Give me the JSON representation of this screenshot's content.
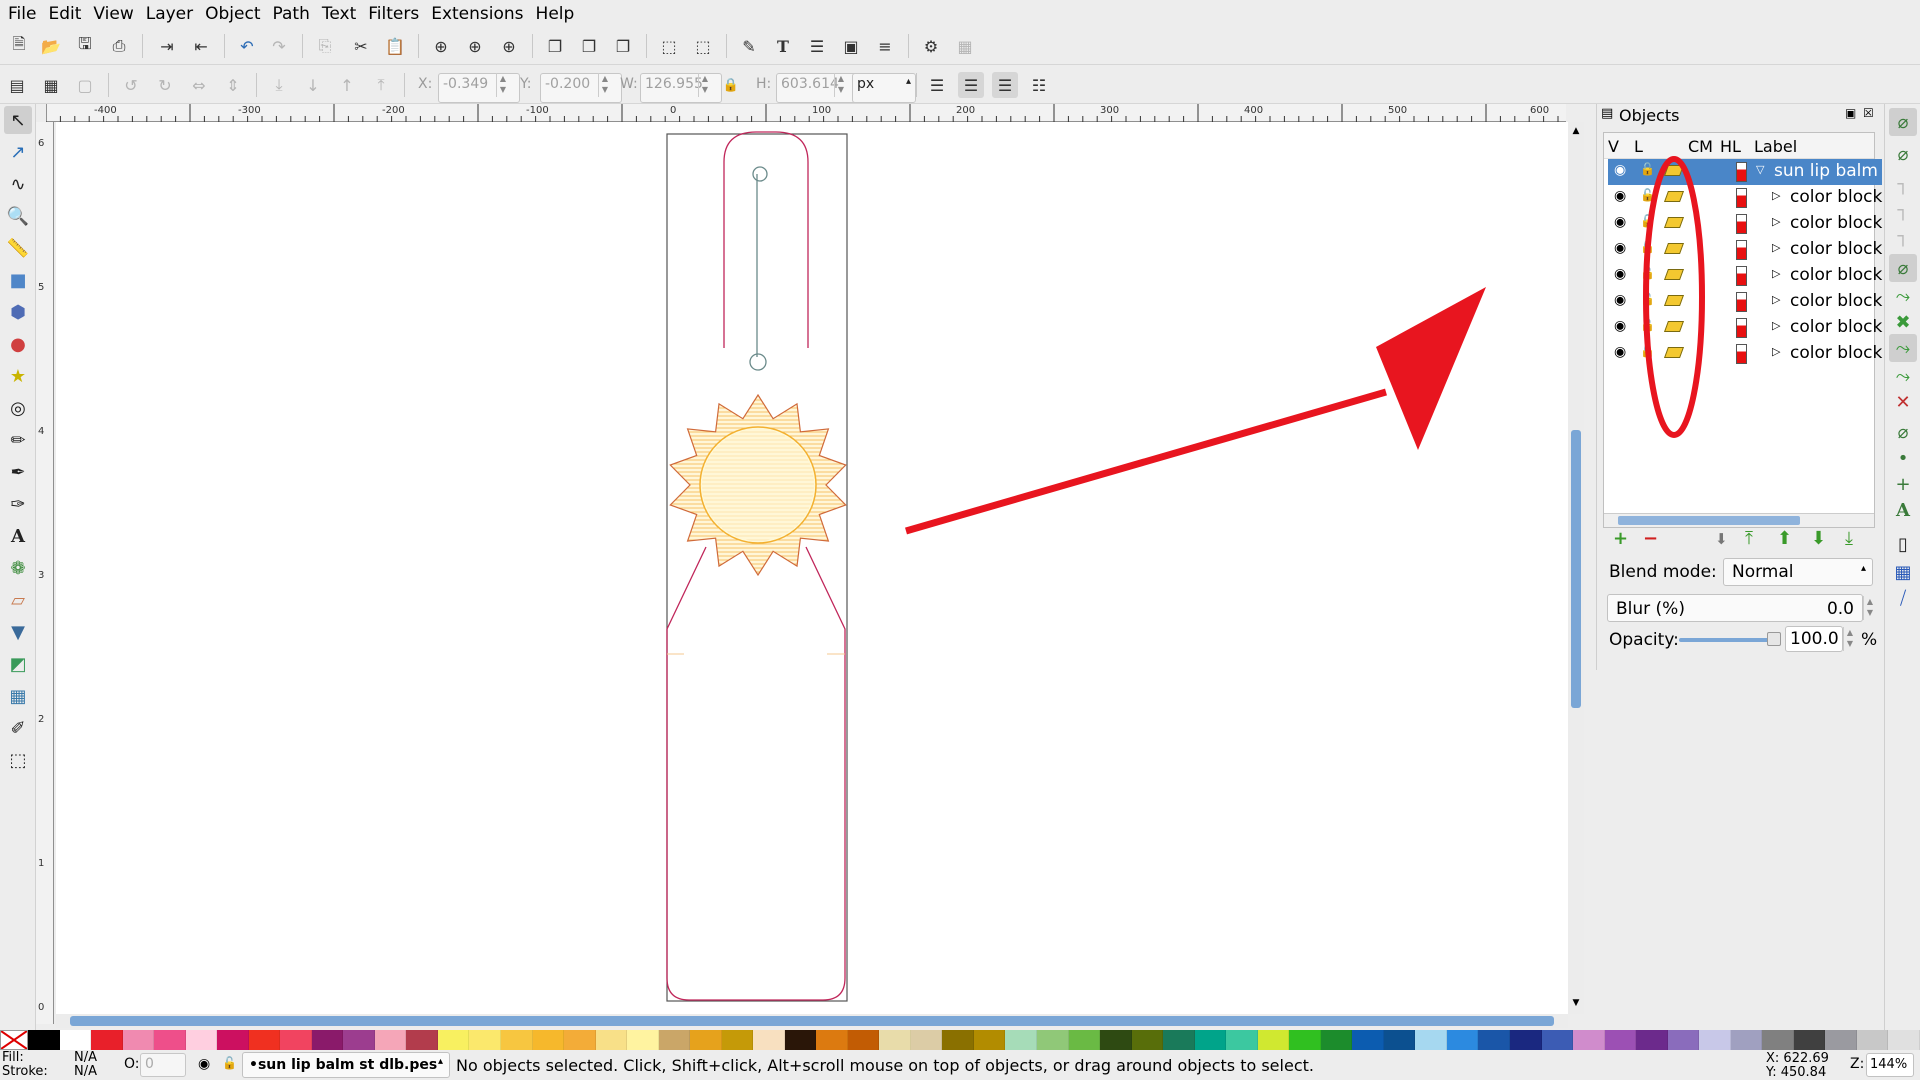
{
  "menu": [
    "File",
    "Edit",
    "View",
    "Layer",
    "Object",
    "Path",
    "Text",
    "Filters",
    "Extensions",
    "Help"
  ],
  "toolbar2": {
    "x_label": "X:",
    "x_value": "-0.349",
    "y_label": "Y:",
    "y_value": "-0.200",
    "w_label": "W:",
    "w_value": "126.955",
    "h_label": "H:",
    "h_value": "603.614",
    "unit": "px"
  },
  "ruler": {
    "h_labels": [
      "-400",
      "-300",
      "-200",
      "-100",
      "0",
      "100",
      "200",
      "300",
      "400",
      "500",
      "600"
    ],
    "v_labels": [
      "6",
      "5",
      "4",
      "3",
      "2",
      "1",
      "0"
    ]
  },
  "objects_panel": {
    "title": "Objects",
    "headers": [
      "V",
      "L",
      "",
      "CM",
      "HL",
      "Label"
    ],
    "rows": [
      {
        "label": "sun lip balm",
        "selected": true
      },
      {
        "label": "color block"
      },
      {
        "label": "color block"
      },
      {
        "label": "color block"
      },
      {
        "label": "color block"
      },
      {
        "label": "color block"
      },
      {
        "label": "color block"
      },
      {
        "label": "color block"
      }
    ],
    "blend_label": "Blend mode:",
    "blend_value": "Normal",
    "blur_label": "Blur (%)",
    "blur_value": "0.0",
    "opacity_label": "Opacity:",
    "opacity_value": "100.0",
    "opacity_unit": "%",
    "opacity_fraction": 1.0
  },
  "colors": {
    "accent": "#4a86c8",
    "annotation": "#e8151f",
    "outline": "#c0265a",
    "sun_fill": "#f7c65a",
    "palette": [
      "#000000",
      "#ffffff",
      "#e8202a",
      "#f08ab0",
      "#ee4f8a",
      "#ffcfe0",
      "#cc1060",
      "#f03020",
      "#f14460",
      "#8a1a6a",
      "#9c3d8f",
      "#f5a6b8",
      "#b23c4c",
      "#f8f060",
      "#fbe86c",
      "#f7c640",
      "#f6b82c",
      "#f3ac38",
      "#f8e088",
      "#fff3a0",
      "#caa668",
      "#e6a21c",
      "#c59a08",
      "#f8e0c0",
      "#2a1608",
      "#dc7a10",
      "#c25c04",
      "#e8dcaa",
      "#dccca6",
      "#8a7000",
      "#b28c00",
      "#a6dcb8",
      "#90c878",
      "#6aba44",
      "#2e4a12",
      "#586e0a",
      "#1a7a5a",
      "#00a48a",
      "#3cc8a0",
      "#d0e830",
      "#30c020",
      "#1c8c2c",
      "#0c5cb0",
      "#0c5090",
      "#a6d8f0",
      "#2c8ae0",
      "#1a56a8",
      "#1a2880",
      "#3c5cb4",
      "#d08ccc",
      "#9c50b4",
      "#6c2a8c",
      "#8a6cbc",
      "#c8c8e8",
      "#a0a0c0",
      "#808080",
      "#404040",
      "#9a9aa0",
      "#c8c8c8",
      "#e0e0e0"
    ]
  },
  "status": {
    "fill_label": "Fill:",
    "fill_value": "N/A",
    "stroke_label": "Stroke:",
    "stroke_value": "N/A",
    "opacity_label": "O:",
    "opacity_value": "0",
    "layer": "•sun lip balm st dlb.pes",
    "message": "No objects selected. Click, Shift+click, Alt+scroll mouse on top of objects, or drag around objects to select.",
    "x_coord": "X: 622.69",
    "y_coord": "Y: 450.84",
    "zoom_label": "Z:",
    "zoom_value": "144%"
  }
}
